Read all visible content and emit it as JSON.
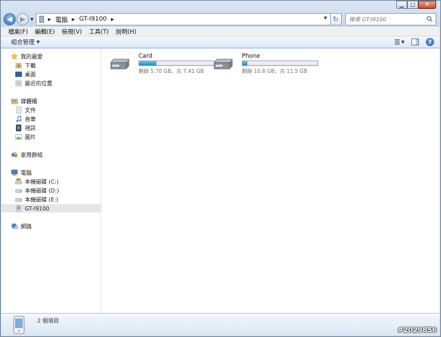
{
  "window": {
    "caption_buttons": [
      "minimize",
      "maximize",
      "close"
    ]
  },
  "address_bar": {
    "crumbs": [
      "電腦",
      "GT-I9100"
    ]
  },
  "search": {
    "placeholder": "搜尋 GT-I9100"
  },
  "menu": [
    "檔案(F)",
    "編輯(E)",
    "檢視(V)",
    "工具(T)",
    "說明(H)"
  ],
  "toolbar": {
    "organize_label": "組合管理"
  },
  "nav": {
    "favorites": {
      "label": "我的最愛",
      "items": [
        "下載",
        "桌面",
        "最近的位置"
      ]
    },
    "libraries": {
      "label": "媒體櫃",
      "items": [
        "文件",
        "音樂",
        "視訊",
        "圖片"
      ]
    },
    "homegroup": "家用群組",
    "computer": {
      "label": "電腦",
      "items": [
        "本機磁碟 (C:)",
        "本機磁碟 (D:)",
        "本機磁碟 (E:)",
        "GT-I9100"
      ]
    },
    "network": "網路"
  },
  "drives": [
    {
      "name": "Card",
      "free_text": "剩餘 5.70 GB，共 7.41 GB",
      "used_fraction": 0.23,
      "bar_color": "#2a9fd6"
    },
    {
      "name": "Phone",
      "free_text": "剩餘 10.8 GB，共 11.5 GB",
      "used_fraction": 0.06,
      "bar_color": "#2a9fd6"
    }
  ],
  "details": {
    "item_count": "2 個項目"
  },
  "watermark": "#2029856"
}
